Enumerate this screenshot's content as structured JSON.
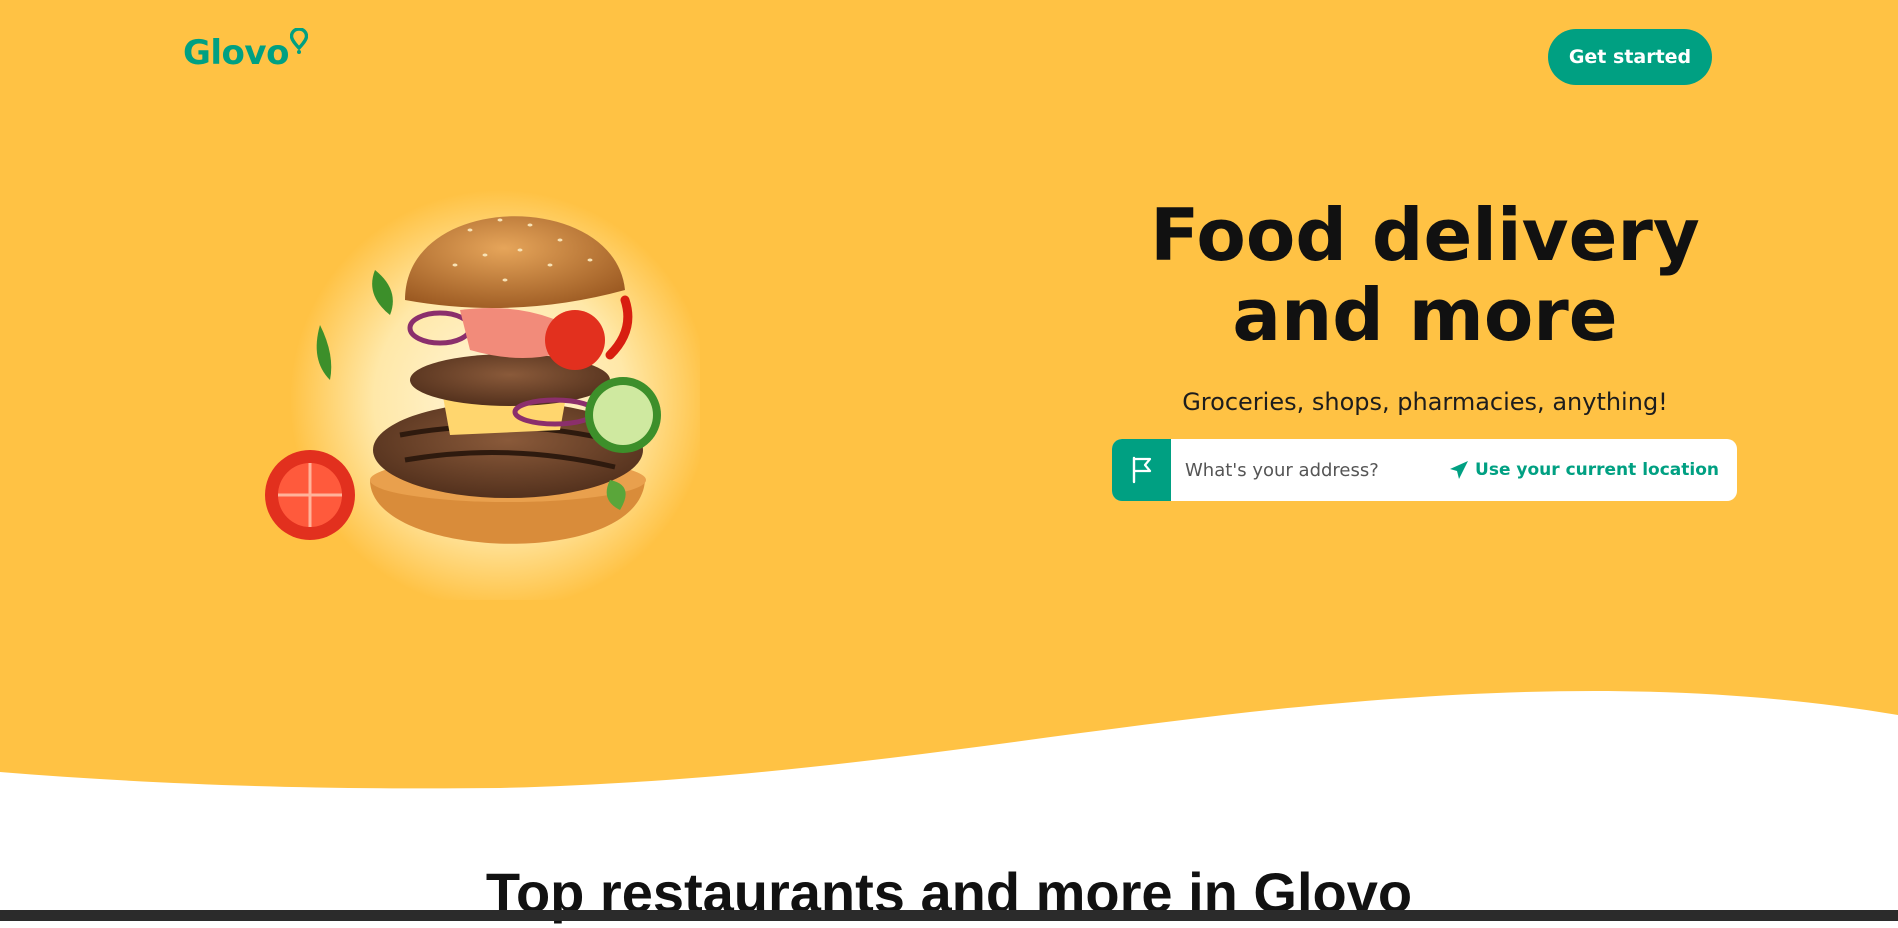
{
  "header": {
    "logo_text": "Glovo",
    "cta_label": "Get started"
  },
  "hero": {
    "headline": "Food delivery and more",
    "subline": "Groceries, shops, pharmacies, anything!",
    "address_placeholder": "What's your address?",
    "location_label": "Use your current location",
    "image": "burger-photo"
  },
  "section": {
    "title": "Top restaurants and more in Glovo"
  },
  "colors": {
    "hero_bg": "#ffc244",
    "accent": "#00a082",
    "page_bg": "#ffffff"
  },
  "icons": [
    "location-pin-icon",
    "flag-icon",
    "send-arrow-icon"
  ]
}
